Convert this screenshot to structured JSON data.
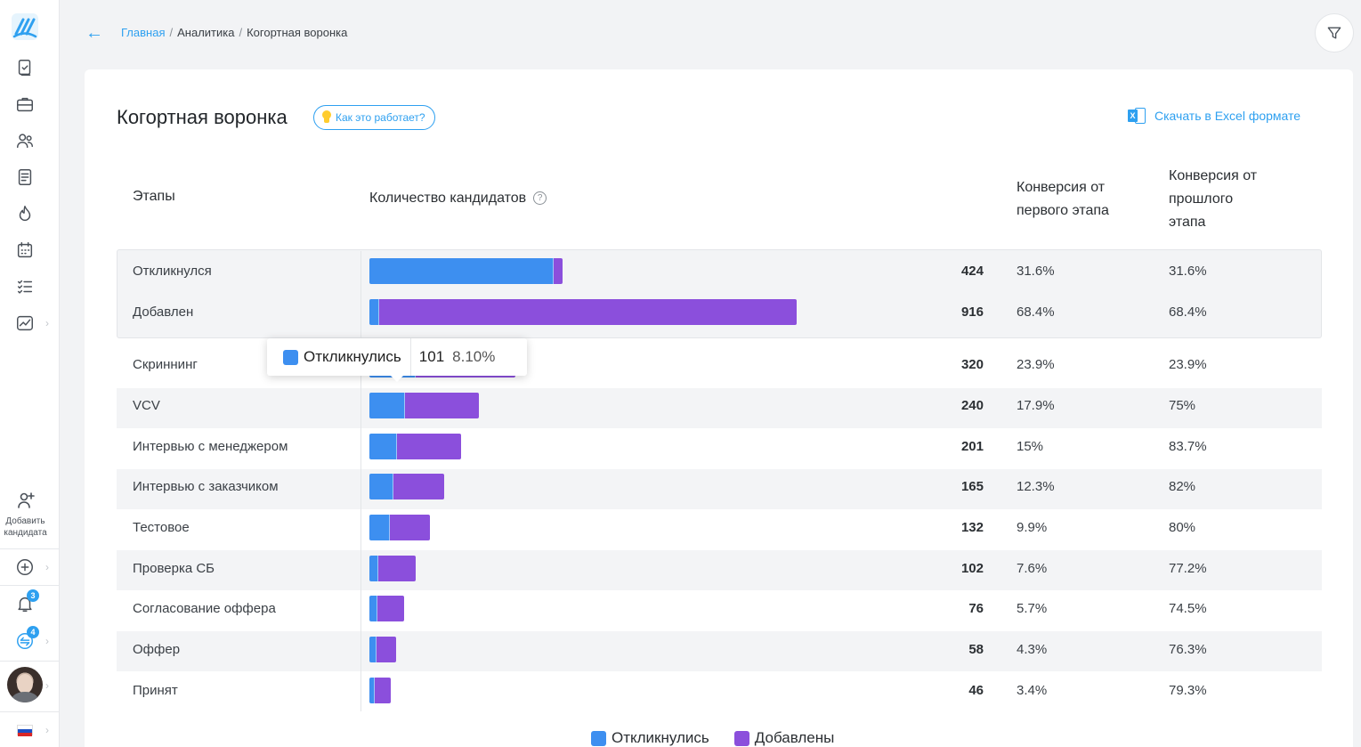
{
  "breadcrumb": {
    "home": "Главная",
    "section": "Аналитика",
    "current": "Когортная воронка",
    "separator": "/"
  },
  "page": {
    "title": "Когортная воронка",
    "how_it_works": "Как это работает?",
    "excel_download": "Скачать в Excel формате"
  },
  "sidebar": {
    "add_candidate_line1": "Добавить",
    "add_candidate_line2": "кандидата",
    "notifications_badge": "3",
    "messages_badge": "4",
    "icons": [
      "logo-icon",
      "documents-check-icon",
      "briefcase-icon",
      "users-icon",
      "document-icon",
      "fire-icon",
      "calendar-icon",
      "checklist-icon",
      "analytics-chart-icon",
      "plus-circle-icon",
      "bell-icon",
      "messages-icon",
      "flag-ru-icon"
    ]
  },
  "table": {
    "headers": {
      "stages": "Этапы",
      "count": "Количество кандидатов",
      "count_help": "?",
      "conv_first_l1": "Конверсия от",
      "conv_first_l2": "первого этапа",
      "conv_prev_l1": "Конверсия от",
      "conv_prev_l2": "прошлого",
      "conv_prev_l3": "этапа"
    }
  },
  "chart_data": {
    "type": "bar",
    "orientation": "horizontal-stacked",
    "categories": [
      "Откликнулся",
      "Добавлен",
      "Скриннинг",
      "VCV",
      "Интервью с менеджером",
      "Интервью с заказчиком",
      "Тестовое",
      "Проверка СБ",
      "Согласование оффера",
      "Оффер",
      "Принят"
    ],
    "totals": [
      "424",
      "916",
      "320",
      "240",
      "201",
      "165",
      "132",
      "102",
      "76",
      "58",
      "46"
    ],
    "conversion_from_first": [
      "31.6%",
      "68.4%",
      "23.9%",
      "17.9%",
      "15%",
      "12.3%",
      "9.9%",
      "7.6%",
      "5.7%",
      "4.3%",
      "3.4%"
    ],
    "conversion_from_previous": [
      "31.6%",
      "68.4%",
      "23.9%",
      "75%",
      "83.7%",
      "82%",
      "80%",
      "77.2%",
      "74.5%",
      "76.3%",
      "79.3%"
    ],
    "series": [
      {
        "name": "Откликнулись",
        "color": "#3d8ff0",
        "values": [
          405,
          0,
          101,
          78,
          60,
          52,
          45,
          20,
          18,
          15,
          12
        ]
      },
      {
        "name": "Добавлены",
        "color": "#8b4fdc",
        "values": [
          19,
          916,
          219,
          162,
          141,
          113,
          87,
          82,
          58,
          43,
          34
        ]
      }
    ],
    "xlim": [
      0,
      916
    ]
  },
  "tooltip": {
    "series": "Откликнулись",
    "value": "101",
    "percent": "8.10%"
  },
  "legend": {
    "responded": "Откликнулись",
    "added": "Добавлены"
  }
}
